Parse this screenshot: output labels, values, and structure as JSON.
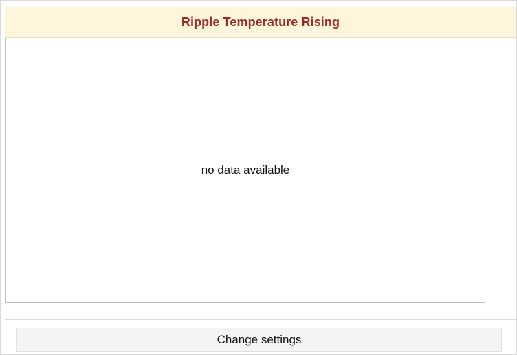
{
  "widget": {
    "title": "Ripple Temperature Rising",
    "empty_message": "no data available",
    "settings_button_label": "Change settings"
  },
  "colors": {
    "header_background": "#fdf6dc",
    "title_text": "#9e2a26",
    "button_background": "#f4f4f4"
  }
}
